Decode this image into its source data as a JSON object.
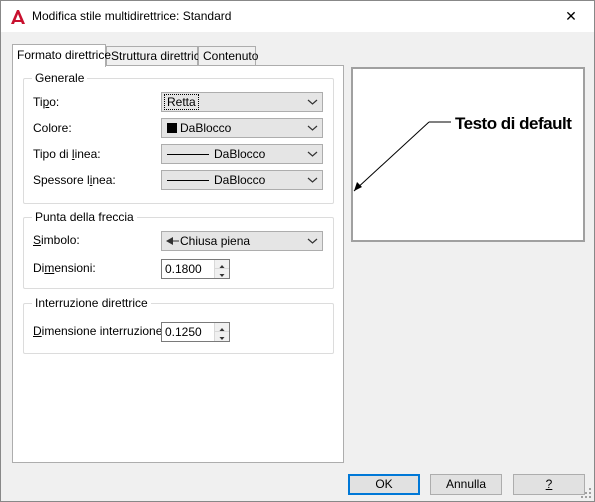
{
  "window": {
    "title": "Modifica stile multidirettrice: Standard",
    "close_glyph": "✕"
  },
  "tabs": [
    {
      "label": "Formato direttrice",
      "active": true
    },
    {
      "label": "Struttura direttrice",
      "active": false
    },
    {
      "label": "Contenuto",
      "active": false
    }
  ],
  "general": {
    "title": "Generale",
    "type_label_pre": "Ti",
    "type_label_ul": "p",
    "type_label_post": "o:",
    "type_value": "Retta",
    "color_label": "Colore:",
    "color_value": "DaBlocco",
    "linetype_label_pre": "Tipo di ",
    "linetype_label_ul": "l",
    "linetype_label_post": "inea:",
    "linetype_value": "DaBlocco",
    "lineweight_label_pre": "Spessore l",
    "lineweight_label_ul": "i",
    "lineweight_label_post": "nea:",
    "lineweight_value": "DaBlocco"
  },
  "arrowhead": {
    "title": "Punta della freccia",
    "symbol_label_pre": "",
    "symbol_label_ul": "S",
    "symbol_label_post": "imbolo:",
    "symbol_value": "Chiusa piena",
    "size_label_pre": "Di",
    "size_label_ul": "m",
    "size_label_post": "ensioni:",
    "size_value": "0.1800"
  },
  "landing_break": {
    "title": "Interruzione direttrice",
    "break_label_pre": "",
    "break_label_ul": "D",
    "break_label_post": "imensione interruzione:",
    "break_value": "0.1250"
  },
  "preview": {
    "text": "Testo di default"
  },
  "buttons": {
    "ok": "OK",
    "cancel": "Annulla",
    "help": "?"
  },
  "colors": {
    "accent": "#0078d7",
    "app_icon": "#c8102e"
  }
}
